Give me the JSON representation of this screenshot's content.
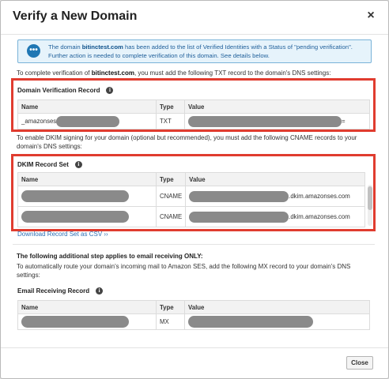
{
  "dialog": {
    "title": "Verify a New Domain",
    "close_icon": "×",
    "close_button": "Close"
  },
  "notice": {
    "icon": "chat-bubble-icon",
    "text_1": "The domain ",
    "domain": "bitinctest.com",
    "text_2": " has been added to the list of Verified Identities with a Status of \"pending verification\". Further action is needed to complete verification of this domain. See details below."
  },
  "txt_intro": {
    "text_1": "To complete verification of ",
    "domain": "bitinctest.com",
    "text_2": ", you must add the following TXT record to the domain's DNS settings:"
  },
  "domain_record": {
    "title": "Domain Verification Record",
    "columns": [
      "Name",
      "Type",
      "Value"
    ],
    "row": {
      "name_prefix": "_amazonses",
      "type": "TXT",
      "value_suffix": "="
    }
  },
  "dkim_intro": "To enable DKIM signing for your domain (optional but recommended), you must add the following CNAME records to your domain's DNS settings:",
  "dkim": {
    "title": "DKIM Record Set",
    "columns": [
      "Name",
      "Type",
      "Value"
    ],
    "rows": [
      {
        "type": "CNAME",
        "value_suffix": ".dkim.amazonses.com"
      },
      {
        "type": "CNAME",
        "value_suffix": ".dkim.amazonses.com"
      }
    ]
  },
  "download_link": "Download Record Set as CSV ››",
  "receiving": {
    "heading": "The following additional step applies to email receiving ONLY:",
    "intro": "To automatically route your domain's incoming mail to Amazon SES, add the following MX record to your domain's DNS settings:",
    "title": "Email Receiving Record",
    "columns": [
      "Name",
      "Type",
      "Value"
    ],
    "row": {
      "type": "MX"
    }
  },
  "colors": {
    "highlight": "#e03c2f",
    "link": "#2d6fb5",
    "notice_bg": "#e6f3fb"
  }
}
